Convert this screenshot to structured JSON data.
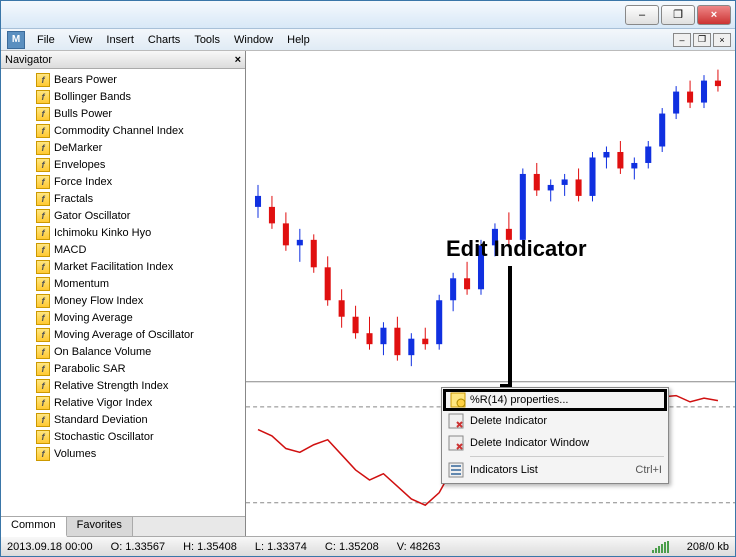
{
  "titlebar": {
    "close": "×",
    "min": "–",
    "restore": "❐"
  },
  "menubar": {
    "file": "File",
    "view": "View",
    "insert": "Insert",
    "charts": "Charts",
    "tools": "Tools",
    "window": "Window",
    "help": "Help"
  },
  "mdi": {
    "min": "–",
    "restore": "❐",
    "close": "×"
  },
  "navigator": {
    "title": "Navigator",
    "close": "×",
    "indicators": [
      "Bears Power",
      "Bollinger Bands",
      "Bulls Power",
      "Commodity Channel Index",
      "DeMarker",
      "Envelopes",
      "Force Index",
      "Fractals",
      "Gator Oscillator",
      "Ichimoku Kinko Hyo",
      "MACD",
      "Market Facilitation Index",
      "Momentum",
      "Money Flow Index",
      "Moving Average",
      "Moving Average of Oscillator",
      "On Balance Volume",
      "Parabolic SAR",
      "Relative Strength Index",
      "Relative Vigor Index",
      "Standard Deviation",
      "Stochastic Oscillator",
      "Volumes"
    ],
    "tabs": {
      "common": "Common",
      "favorites": "Favorites"
    }
  },
  "annotation": {
    "label": "Edit Indicator"
  },
  "context_menu": {
    "properties": "%R(14) properties...",
    "delete_ind": "Delete Indicator",
    "delete_win": "Delete Indicator Window",
    "list": "Indicators List",
    "list_shortcut": "Ctrl+I"
  },
  "status": {
    "date": "2013.09.18 00:00",
    "open": "O: 1.33567",
    "high": "H: 1.35408",
    "low": "L: 1.33374",
    "close": "C: 1.35208",
    "vol": "V: 48263",
    "kb": "208/0 kb"
  },
  "chart_data": {
    "type": "candlestick",
    "note": "approximate OHLC readings from pixels, red=down blue=up",
    "candles": [
      {
        "o": 1.344,
        "h": 1.346,
        "l": 1.34,
        "c": 1.342,
        "d": "up"
      },
      {
        "o": 1.342,
        "h": 1.344,
        "l": 1.338,
        "c": 1.339,
        "d": "down"
      },
      {
        "o": 1.339,
        "h": 1.341,
        "l": 1.334,
        "c": 1.335,
        "d": "down"
      },
      {
        "o": 1.335,
        "h": 1.338,
        "l": 1.332,
        "c": 1.336,
        "d": "up"
      },
      {
        "o": 1.336,
        "h": 1.337,
        "l": 1.33,
        "c": 1.331,
        "d": "down"
      },
      {
        "o": 1.331,
        "h": 1.333,
        "l": 1.324,
        "c": 1.325,
        "d": "down"
      },
      {
        "o": 1.325,
        "h": 1.327,
        "l": 1.32,
        "c": 1.322,
        "d": "down"
      },
      {
        "o": 1.322,
        "h": 1.324,
        "l": 1.318,
        "c": 1.319,
        "d": "down"
      },
      {
        "o": 1.319,
        "h": 1.322,
        "l": 1.316,
        "c": 1.317,
        "d": "down"
      },
      {
        "o": 1.317,
        "h": 1.321,
        "l": 1.315,
        "c": 1.32,
        "d": "up"
      },
      {
        "o": 1.32,
        "h": 1.322,
        "l": 1.314,
        "c": 1.315,
        "d": "down"
      },
      {
        "o": 1.315,
        "h": 1.319,
        "l": 1.313,
        "c": 1.318,
        "d": "up"
      },
      {
        "o": 1.318,
        "h": 1.32,
        "l": 1.316,
        "c": 1.317,
        "d": "down"
      },
      {
        "o": 1.317,
        "h": 1.326,
        "l": 1.316,
        "c": 1.325,
        "d": "up"
      },
      {
        "o": 1.325,
        "h": 1.33,
        "l": 1.323,
        "c": 1.329,
        "d": "up"
      },
      {
        "o": 1.329,
        "h": 1.332,
        "l": 1.326,
        "c": 1.327,
        "d": "down"
      },
      {
        "o": 1.327,
        "h": 1.336,
        "l": 1.326,
        "c": 1.335,
        "d": "up"
      },
      {
        "o": 1.335,
        "h": 1.339,
        "l": 1.333,
        "c": 1.338,
        "d": "up"
      },
      {
        "o": 1.338,
        "h": 1.341,
        "l": 1.335,
        "c": 1.336,
        "d": "down"
      },
      {
        "o": 1.336,
        "h": 1.349,
        "l": 1.335,
        "c": 1.348,
        "d": "up"
      },
      {
        "o": 1.348,
        "h": 1.35,
        "l": 1.344,
        "c": 1.345,
        "d": "down"
      },
      {
        "o": 1.345,
        "h": 1.347,
        "l": 1.343,
        "c": 1.346,
        "d": "up"
      },
      {
        "o": 1.346,
        "h": 1.348,
        "l": 1.344,
        "c": 1.347,
        "d": "up"
      },
      {
        "o": 1.347,
        "h": 1.349,
        "l": 1.343,
        "c": 1.344,
        "d": "down"
      },
      {
        "o": 1.344,
        "h": 1.352,
        "l": 1.343,
        "c": 1.351,
        "d": "up"
      },
      {
        "o": 1.351,
        "h": 1.353,
        "l": 1.349,
        "c": 1.352,
        "d": "up"
      },
      {
        "o": 1.352,
        "h": 1.354,
        "l": 1.348,
        "c": 1.349,
        "d": "down"
      },
      {
        "o": 1.349,
        "h": 1.351,
        "l": 1.347,
        "c": 1.35,
        "d": "up"
      },
      {
        "o": 1.35,
        "h": 1.354,
        "l": 1.349,
        "c": 1.353,
        "d": "up"
      },
      {
        "o": 1.353,
        "h": 1.36,
        "l": 1.352,
        "c": 1.359,
        "d": "up"
      },
      {
        "o": 1.359,
        "h": 1.364,
        "l": 1.358,
        "c": 1.363,
        "d": "up"
      },
      {
        "o": 1.363,
        "h": 1.365,
        "l": 1.36,
        "c": 1.361,
        "d": "down"
      },
      {
        "o": 1.361,
        "h": 1.366,
        "l": 1.36,
        "c": 1.365,
        "d": "up"
      },
      {
        "o": 1.365,
        "h": 1.367,
        "l": 1.363,
        "c": 1.364,
        "d": "down"
      }
    ],
    "indicator_line": [
      -30,
      -35,
      -45,
      -48,
      -42,
      -38,
      -50,
      -62,
      -70,
      -65,
      -75,
      -85,
      -90,
      -80,
      -60,
      -45,
      -30,
      -20,
      -15,
      -22,
      -10,
      -18,
      -8,
      -12,
      -5,
      -15,
      -10,
      -6,
      -12,
      -4,
      -3,
      -8,
      -5,
      -7
    ],
    "indicator_range": [
      -100,
      0
    ]
  }
}
